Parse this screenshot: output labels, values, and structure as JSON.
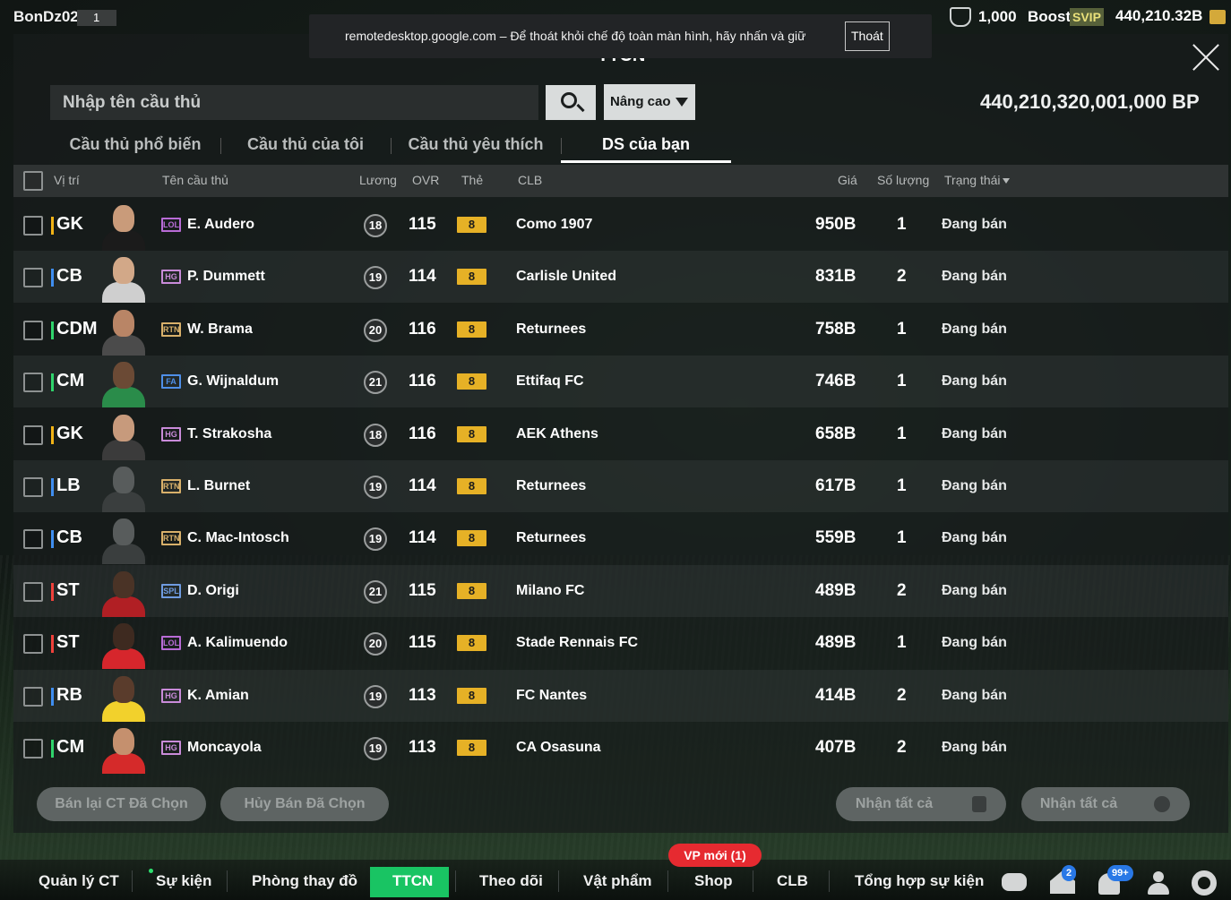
{
  "topbar": {
    "username": "BonDz02",
    "level": "1",
    "remote_desktop_notice": "remotedesktop.google.com – Để thoát khỏi chế độ toàn màn hình, hãy nhấn và giữ",
    "remote_desktop_exit": "Thoát",
    "resource_value": "1,000",
    "boost_label": "Boost",
    "svip_label": "SVIP",
    "bp_balance": "440,210.32B"
  },
  "window": {
    "title_partial": "TTCN"
  },
  "search": {
    "placeholder": "Nhập tên cầu thủ",
    "advanced_label": "Nâng cao"
  },
  "bp_total": "440,210,320,001,000 BP",
  "tabs": [
    {
      "label": "Cầu thủ phổ biến",
      "active": false
    },
    {
      "label": "Cầu thủ của tôi",
      "active": false
    },
    {
      "label": "Cầu thủ yêu thích",
      "active": false
    },
    {
      "label": "DS của bạn",
      "active": true
    }
  ],
  "table": {
    "headers": {
      "position": "Vị trí",
      "name": "Tên cầu thủ",
      "wage": "Lương",
      "ovr": "OVR",
      "grade": "Thẻ",
      "club": "CLB",
      "price": "Giá",
      "quantity": "Số lượng",
      "status": "Trạng thái"
    },
    "rows": [
      {
        "position": "GK",
        "pos_color": "#f2b316",
        "season": "LOL",
        "season_color": "#b86bd6",
        "name": "E. Audero",
        "wage": "18",
        "ovr": "115",
        "grade": "8",
        "club": "Como 1907",
        "price": "950B",
        "quantity": "1",
        "status": "Đang bán"
      },
      {
        "position": "CB",
        "pos_color": "#3f8ef0",
        "season": "HG",
        "season_color": "#c98bd9",
        "name": "P. Dummett",
        "wage": "19",
        "ovr": "114",
        "grade": "8",
        "club": "Carlisle United",
        "price": "831B",
        "quantity": "2",
        "status": "Đang bán"
      },
      {
        "position": "CDM",
        "pos_color": "#2fd36b",
        "season": "RTN",
        "season_color": "#d8b06a",
        "name": "W. Brama",
        "wage": "20",
        "ovr": "116",
        "grade": "8",
        "club": "Returnees",
        "price": "758B",
        "quantity": "1",
        "status": "Đang bán"
      },
      {
        "position": "CM",
        "pos_color": "#2fd36b",
        "season": "FA",
        "season_color": "#4f8fe8",
        "name": "G. Wijnaldum",
        "wage": "21",
        "ovr": "116",
        "grade": "8",
        "club": "Ettifaq FC",
        "price": "746B",
        "quantity": "1",
        "status": "Đang bán"
      },
      {
        "position": "GK",
        "pos_color": "#f2b316",
        "season": "HG",
        "season_color": "#c98bd9",
        "name": "T. Strakosha",
        "wage": "18",
        "ovr": "116",
        "grade": "8",
        "club": "AEK Athens",
        "price": "658B",
        "quantity": "1",
        "status": "Đang bán"
      },
      {
        "position": "LB",
        "pos_color": "#3f8ef0",
        "season": "RTN",
        "season_color": "#d8b06a",
        "name": "L. Burnet",
        "wage": "19",
        "ovr": "114",
        "grade": "8",
        "club": "Returnees",
        "price": "617B",
        "quantity": "1",
        "status": "Đang bán"
      },
      {
        "position": "CB",
        "pos_color": "#3f8ef0",
        "season": "RTN",
        "season_color": "#d8b06a",
        "name": "C. Mac-Intosch",
        "wage": "19",
        "ovr": "114",
        "grade": "8",
        "club": "Returnees",
        "price": "559B",
        "quantity": "1",
        "status": "Đang bán"
      },
      {
        "position": "ST",
        "pos_color": "#f0413b",
        "season": "SPL",
        "season_color": "#6f9be0",
        "name": "D. Origi",
        "wage": "21",
        "ovr": "115",
        "grade": "8",
        "club": "Milano FC",
        "price": "489B",
        "quantity": "2",
        "status": "Đang bán"
      },
      {
        "position": "ST",
        "pos_color": "#f0413b",
        "season": "LOL",
        "season_color": "#b86bd6",
        "name": "A. Kalimuendo",
        "wage": "20",
        "ovr": "115",
        "grade": "8",
        "club": "Stade Rennais FC",
        "price": "489B",
        "quantity": "1",
        "status": "Đang bán"
      },
      {
        "position": "RB",
        "pos_color": "#3f8ef0",
        "season": "HG",
        "season_color": "#c98bd9",
        "name": "K. Amian",
        "wage": "19",
        "ovr": "113",
        "grade": "8",
        "club": "FC Nantes",
        "price": "414B",
        "quantity": "2",
        "status": "Đang bán"
      },
      {
        "position": "CM",
        "pos_color": "#2fd36b",
        "season": "HG",
        "season_color": "#c98bd9",
        "name": "Moncayola",
        "wage": "19",
        "ovr": "113",
        "grade": "8",
        "club": "CA Osasuna",
        "price": "407B",
        "quantity": "2",
        "status": "Đang bán"
      }
    ]
  },
  "actions": {
    "resell_selected": "Bán lại CT Đã Chọn",
    "cancel_selected": "Hủy Bán Đã Chọn",
    "claim_all_1": "Nhận tất cả",
    "claim_all_2": "Nhận tất cả"
  },
  "bottom_nav": {
    "items": [
      "Quản lý CT",
      "Sự kiện",
      "Phòng thay đồ",
      "TTCN",
      "Theo dõi",
      "Vật phẩm",
      "Shop",
      "CLB",
      "Tổng hợp sự kiện"
    ],
    "active": "TTCN",
    "new_items_badge": "VP mới (1)",
    "house_badge": "2",
    "bell_badge": "99+"
  }
}
